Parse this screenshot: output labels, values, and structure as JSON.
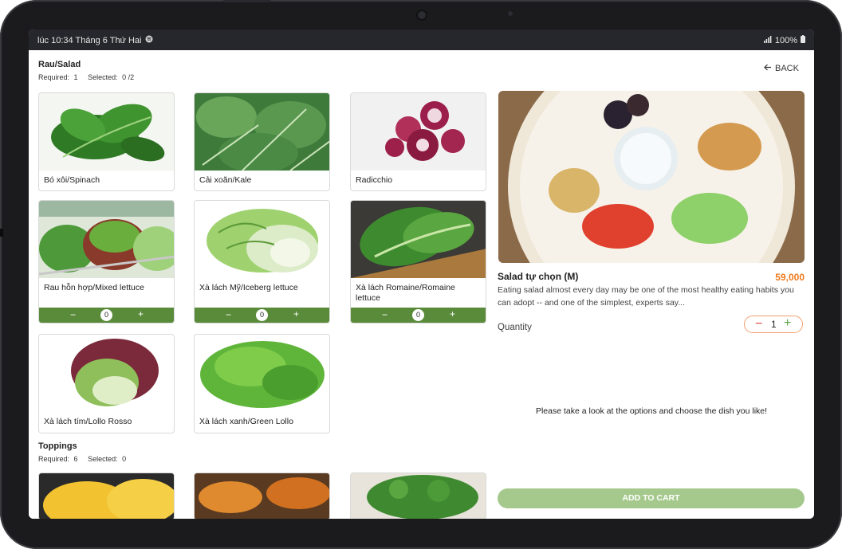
{
  "status_bar": {
    "time_text": "lúc 10:34 Tháng 6 Thứ Hai",
    "battery_text": "100%"
  },
  "options": {
    "back_label": "BACK",
    "rau_salad": {
      "title": "Rau/Salad",
      "required_label": "Required:",
      "required_value": "1",
      "selected_label": "Selected:",
      "selected_value": "0 /2",
      "items": [
        {
          "label": "Bó xôi/Spinach"
        },
        {
          "label": "Cải xoăn/Kale"
        },
        {
          "label": "Radicchio"
        },
        {
          "label": "Rau hỗn hợp/Mixed lettuce",
          "minus": "−",
          "count": "0",
          "plus": "+"
        },
        {
          "label": "Xà lách Mỹ/Iceberg lettuce",
          "minus": "−",
          "count": "0",
          "plus": "+"
        },
        {
          "label": "Xà lách Romaine/Romaine lettuce",
          "minus": "−",
          "count": "0",
          "plus": "+"
        },
        {
          "label": "Xà lách tím/Lollo Rosso"
        },
        {
          "label": "Xà lách xanh/Green Lollo"
        }
      ]
    },
    "toppings": {
      "title": "Toppings",
      "required_label": "Required:",
      "required_value": "6",
      "selected_label": "Selected:",
      "selected_value": "0"
    }
  },
  "dish": {
    "name": "Salad tự chọn (M)",
    "price": "59,000",
    "description": "Eating salad almost every day may be one of the most healthy eating habits you can adopt -- and one of the simplest, experts say...",
    "quantity_label": "Quantity",
    "quantity_minus": "−",
    "quantity_value": "1",
    "quantity_plus": "+",
    "hint": "Please take a look at the options and choose the dish you like!",
    "add_to_cart_label": "ADD TO CART"
  },
  "colors": {
    "accent_green": "#5a8b3b",
    "cart_button": "#a5c98c",
    "price_orange": "#f07a1d"
  }
}
